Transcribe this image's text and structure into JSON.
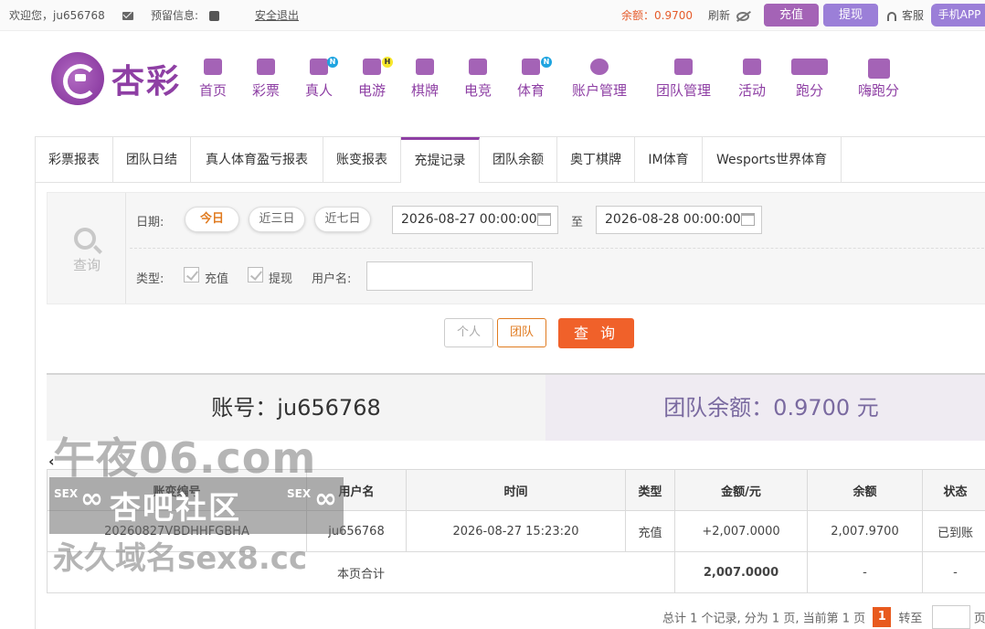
{
  "topbar": {
    "welcome": "欢迎您，ju656768",
    "reserved_info": "预留信息:",
    "logout": "安全退出",
    "balance_label": "余额：",
    "balance_value": "0.9700",
    "refresh": "刷新",
    "deposit": "充值",
    "withdraw": "提现",
    "service": "客服",
    "mobile_app": "手机APP"
  },
  "logo": {
    "text": "杏彩"
  },
  "nav": [
    {
      "label": "首页",
      "icon": "home-icon"
    },
    {
      "label": "彩票",
      "icon": "ticket-icon"
    },
    {
      "label": "真人",
      "icon": "live-dealer-icon",
      "badge": "N"
    },
    {
      "label": "电游",
      "icon": "gamepad-icon",
      "badge": "H"
    },
    {
      "label": "棋牌",
      "icon": "cards-icon"
    },
    {
      "label": "电竞",
      "icon": "esports-controller-icon"
    },
    {
      "label": "体育",
      "icon": "trophy-icon",
      "badge": "N"
    },
    {
      "label": "账户管理",
      "icon": "yen-coin-icon"
    },
    {
      "label": "团队管理",
      "icon": "team-icon"
    },
    {
      "label": "活动",
      "icon": "gift-icon"
    },
    {
      "label": "跑分",
      "icon": "run-score-icon"
    },
    {
      "label": "嗨跑分",
      "icon": "hi-run-score-icon"
    }
  ],
  "tabs": [
    "彩票报表",
    "团队日结",
    "真人体育盈亏报表",
    "账变报表",
    "充提记录",
    "团队余额",
    "奥丁棋牌",
    "IM体育",
    "Wesports世界体育"
  ],
  "filter": {
    "search_label": "查询",
    "date_label": "日期:",
    "ranges": [
      "今日",
      "近三日",
      "近七日"
    ],
    "start_date": "2026-08-27 00:00:00",
    "to_label": "至",
    "end_date": "2026-08-28 00:00:00",
    "type_label": "类型:",
    "types": [
      "充值",
      "提现"
    ],
    "username_label": "用户名:",
    "username_value": ""
  },
  "actions": {
    "personal": "个人",
    "team": "团队",
    "query": "查 询"
  },
  "summary": {
    "account": "账号：ju656768",
    "team_balance": "团队余额：0.9700 元"
  },
  "table": {
    "columns": [
      "账变编号",
      "用户名",
      "时间",
      "类型",
      "金额/元",
      "余额",
      "状态"
    ],
    "rows": [
      [
        "20260827VBDHHFGBHA",
        "ju656768",
        "2026-08-27 15:23:20",
        "充值",
        "+2,007.0000",
        "2,007.9700",
        "已到账"
      ]
    ],
    "footer": {
      "label": "本页合计",
      "amount": "2,007.0000",
      "balance": "-",
      "status": "-"
    }
  },
  "pager": {
    "summary": "总计 1 个记录, 分为 1 页, 当前第 1 页",
    "current": "1",
    "goto": "转至",
    "suffix": "页"
  },
  "watermark": {
    "line1": "午夜06.com",
    "sex": "SEX",
    "line2": "杏吧社区",
    "line3": "永久域名sex8.cc"
  },
  "colors": {
    "brand": "#8e3fa4",
    "accent": "#f0612a",
    "success": "#4b9a2d"
  }
}
